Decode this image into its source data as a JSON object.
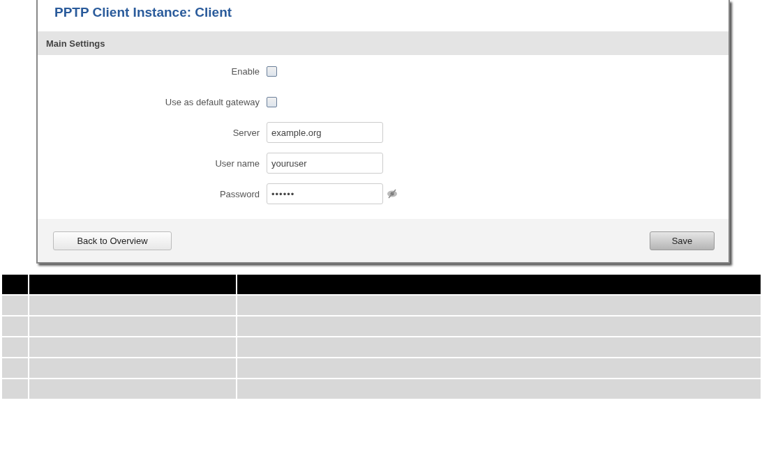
{
  "title": "PPTP Client Instance: Client",
  "section": {
    "title": "Main Settings"
  },
  "fields": [
    {
      "kind": "checkbox",
      "label": "Enable",
      "checked": false
    },
    {
      "kind": "checkbox",
      "label": "Use as default gateway",
      "checked": false
    },
    {
      "kind": "text",
      "label": "Server",
      "value": "example.org"
    },
    {
      "kind": "text",
      "label": "User name",
      "value": "youruser"
    },
    {
      "kind": "password",
      "label": "Password",
      "value": "••••••"
    }
  ],
  "buttons": {
    "back": "Back to Overview",
    "save": "Save"
  }
}
